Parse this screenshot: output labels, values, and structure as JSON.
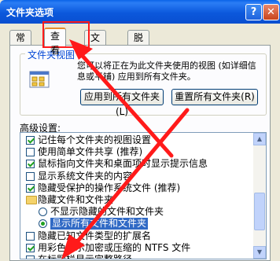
{
  "window": {
    "title": "文件夹选项",
    "help_label": "?",
    "close_label": "✕"
  },
  "tabs": [
    {
      "label": "常规"
    },
    {
      "label": "查看"
    },
    {
      "label": "文件类型"
    },
    {
      "label": "脱机文件"
    }
  ],
  "folder_views": {
    "legend": "文件夹视图",
    "description": "您可以将正在为此文件夹使用的视图 (如详细信息或平铺) 应用到所有文件夹。",
    "apply_all_label": "应用到所有文件夹(L)",
    "reset_all_label": "重置所有文件夹(R)"
  },
  "advanced": {
    "label": "高级设置:",
    "items": [
      {
        "kind": "checkbox",
        "checked": true,
        "text": "记住每个文件夹的视图设置"
      },
      {
        "kind": "checkbox",
        "checked": false,
        "text": "使用简单文件共享 (推荐)"
      },
      {
        "kind": "checkbox",
        "checked": true,
        "text": "鼠标指向文件夹和桌面项时显示提示信息"
      },
      {
        "kind": "checkbox",
        "checked": false,
        "text": "显示系统文件夹的内容"
      },
      {
        "kind": "checkbox",
        "checked": true,
        "text": "隐藏受保护的操作系统文件 (推荐)"
      },
      {
        "kind": "folder",
        "checked": false,
        "text": "隐藏文件和文件夹"
      },
      {
        "kind": "radio",
        "checked": false,
        "text": "不显示隐藏的文件和文件夹"
      },
      {
        "kind": "radio",
        "checked": true,
        "text": "显示所有文件和文件夹"
      },
      {
        "kind": "checkbox",
        "checked": false,
        "text": "隐藏已知文件类型的扩展名"
      },
      {
        "kind": "checkbox",
        "checked": true,
        "text": "用彩色显示加密或压缩的 NTFS 文件"
      },
      {
        "kind": "checkbox",
        "checked": false,
        "text": "在标题栏显示完整路径"
      }
    ]
  },
  "colors": {
    "annotation_red": "#ff1a1a",
    "selection_blue": "#316ac5"
  }
}
